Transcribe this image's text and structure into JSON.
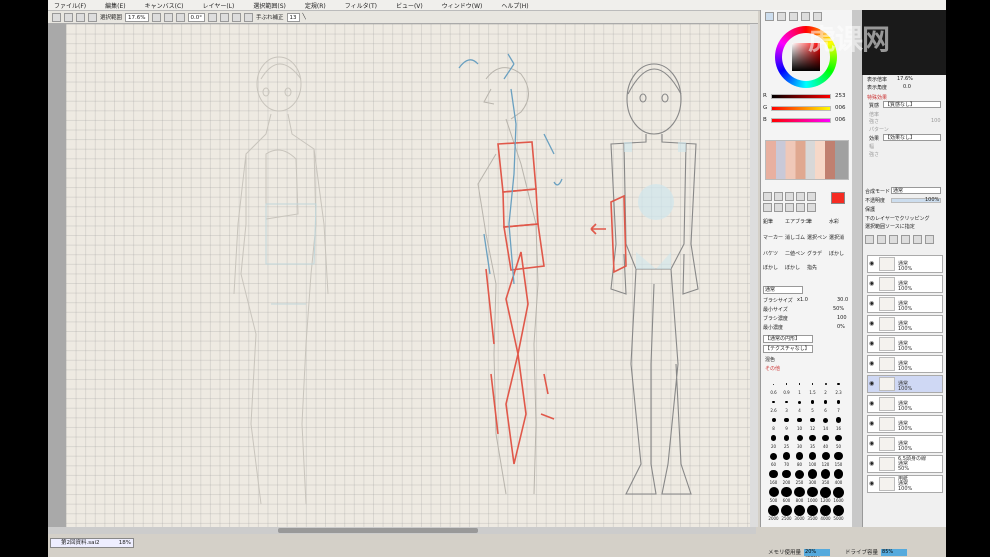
{
  "menu": [
    "ファイル(F)",
    "編集(E)",
    "キャンバス(C)",
    "レイヤー(L)",
    "選択範囲(S)",
    "定規(R)",
    "フィルタ(T)",
    "ビュー(V)",
    "ウィンドウ(W)",
    "ヘルプ(H)"
  ],
  "toolbar": {
    "selection_label": "選択範囲",
    "zoom": "17.6%",
    "angle": "0.0°",
    "stabilizer_label": "手ぶれ補正",
    "stabilizer_value": "13"
  },
  "watermark": "虎课网",
  "color": {
    "r_label": "R",
    "r": "253",
    "g_label": "G",
    "g": "006",
    "b_label": "B",
    "b": "006",
    "current": "#f52b22"
  },
  "nav": {
    "zoom_label": "表示倍率",
    "zoom": "17.6%",
    "angle_label": "表示角度",
    "angle": "0.0"
  },
  "effects": {
    "title": "特殊効果",
    "paper_label": "質感",
    "paper_value": "【質感なし】",
    "scale_label": "倍率",
    "strength_label": "強さ",
    "strength_value": "100",
    "brightness_label": "明るさ",
    "contrast_label": "コントラスト",
    "pattern_label": "パターン",
    "eff_label": "効果",
    "eff_value": "【効果なし】",
    "width_label": "幅",
    "strength2_label": "強さ"
  },
  "layer_props": {
    "blend_label": "合成モード",
    "blend_value": "通常",
    "opacity_label": "不透明度",
    "opacity_value": "100%",
    "protect_label": "保護",
    "clip_label": "下のレイヤーでクリッピング",
    "sel_label": "選択範囲ソースに指定"
  },
  "tools": {
    "row1": [
      "鉛筆",
      "エアブラシ",
      "筆",
      "水彩"
    ],
    "row2": [
      "マーカー",
      "消しゴム",
      "選択ペン",
      "選択消"
    ],
    "row3": [
      "バケツ",
      "二値ペン",
      "グラデ",
      "ぼかし"
    ],
    "row4": [
      "ぼかし",
      "ぼかし",
      "指先"
    ],
    "mode": "通常",
    "size_label": "ブラシサイズ",
    "size_mult": "x1.0",
    "size": "30.0",
    "min_size_label": "最小サイズ",
    "min_size": "50%",
    "density_label": "ブラシ濃度",
    "density": "100",
    "min_density_label": "最小濃度",
    "min_density": "0%",
    "shape_label": "【通常の円形】",
    "texture_label": "【テクスチャなし】",
    "mix_label": "混色",
    "other_label": "その他"
  },
  "brush_sizes": [
    "0.6",
    "0.9",
    "1",
    "1.5",
    "2",
    "2.3",
    "2.6",
    "3",
    "4",
    "5",
    "6",
    "7",
    "8",
    "9",
    "10",
    "12",
    "14",
    "16",
    "20",
    "25",
    "30",
    "35",
    "40",
    "50",
    "60",
    "70",
    "80",
    "100",
    "120",
    "150",
    "160",
    "200",
    "250",
    "300",
    "350",
    "400",
    "500",
    "600",
    "800",
    "1000",
    "1200",
    "1600",
    "2000",
    "2500",
    "3000",
    "3500",
    "4000",
    "5000"
  ],
  "layers": [
    {
      "name": "",
      "mode": "通常",
      "opacity": "100%",
      "sel": false
    },
    {
      "name": "",
      "mode": "通常",
      "opacity": "100%",
      "sel": false
    },
    {
      "name": "",
      "mode": "通常",
      "opacity": "100%",
      "sel": false
    },
    {
      "name": "",
      "mode": "通常",
      "opacity": "100%",
      "sel": false
    },
    {
      "name": "",
      "mode": "通常",
      "opacity": "100%",
      "sel": false
    },
    {
      "name": "",
      "mode": "通常",
      "opacity": "100%",
      "sel": false
    },
    {
      "name": "",
      "mode": "通常",
      "opacity": "100%",
      "sel": true
    },
    {
      "name": "",
      "mode": "通常",
      "opacity": "100%",
      "sel": false
    },
    {
      "name": "",
      "mode": "通常",
      "opacity": "100%",
      "sel": false
    },
    {
      "name": "",
      "mode": "通常",
      "opacity": "100%",
      "sel": false
    },
    {
      "name": "6.5頭身の線",
      "mode": "通常",
      "opacity": "50%",
      "sel": false
    },
    {
      "name": "用紙",
      "mode": "通常",
      "opacity": "100%",
      "sel": false
    }
  ],
  "statusbar": {
    "doc": "第2回資料.sai2",
    "doc_pct": "18%",
    "mem_label": "メモリ使用量",
    "mem": "20% (22%)",
    "disk_label": "ドライブ容量",
    "disk": "85%"
  }
}
